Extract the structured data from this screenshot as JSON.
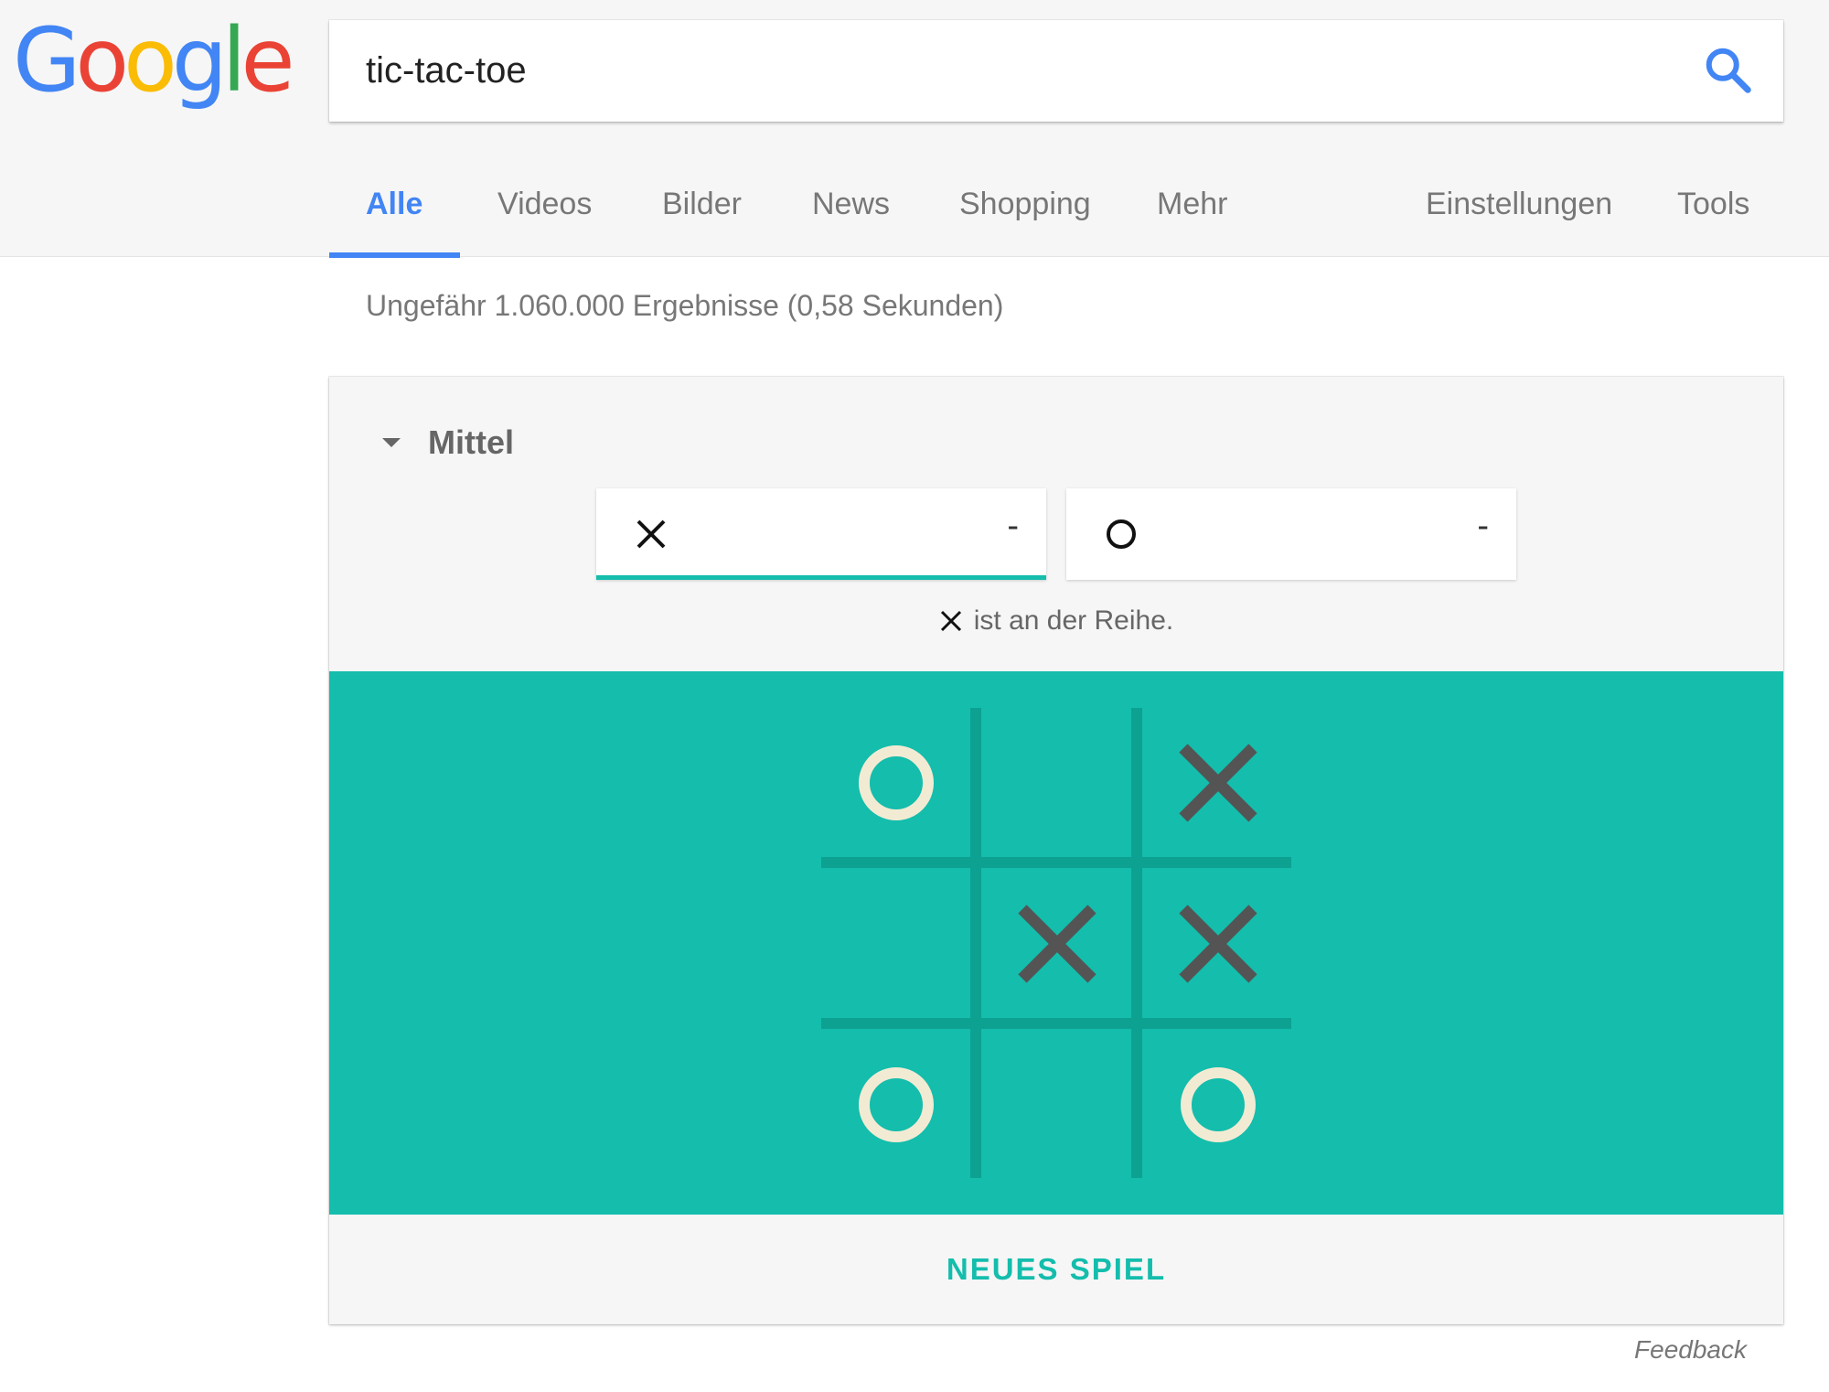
{
  "search": {
    "query": "tic-tac-toe"
  },
  "logo": {
    "text": "Google"
  },
  "tabs": [
    {
      "label": "Alle",
      "active": true
    },
    {
      "label": "Videos"
    },
    {
      "label": "Bilder"
    },
    {
      "label": "News"
    },
    {
      "label": "Shopping"
    },
    {
      "label": "Mehr"
    },
    {
      "label": "Einstellungen"
    },
    {
      "label": "Tools"
    }
  ],
  "result_stats": "Ungefähr 1.060.000 Ergebnisse (0,58 Sekunden)",
  "game": {
    "difficulty": "Mittel",
    "score_x": "-",
    "score_o": "-",
    "turn_text": "ist an der Reihe.",
    "current_player": "X",
    "board": [
      "O",
      "",
      "X",
      "",
      "X",
      "X",
      "O",
      "",
      "O"
    ],
    "new_game_label": "NEUES SPIEL"
  },
  "feedback": "Feedback",
  "colors": {
    "accent": "#4285f4",
    "board": "#14bdac",
    "grid_line": "#0da192",
    "x_mark": "#545454",
    "o_mark": "#f2ebd3"
  },
  "icons": {
    "search": "search-icon",
    "difficulty": "caret-down-icon",
    "x": "x-mark-icon",
    "o": "o-mark-icon"
  }
}
